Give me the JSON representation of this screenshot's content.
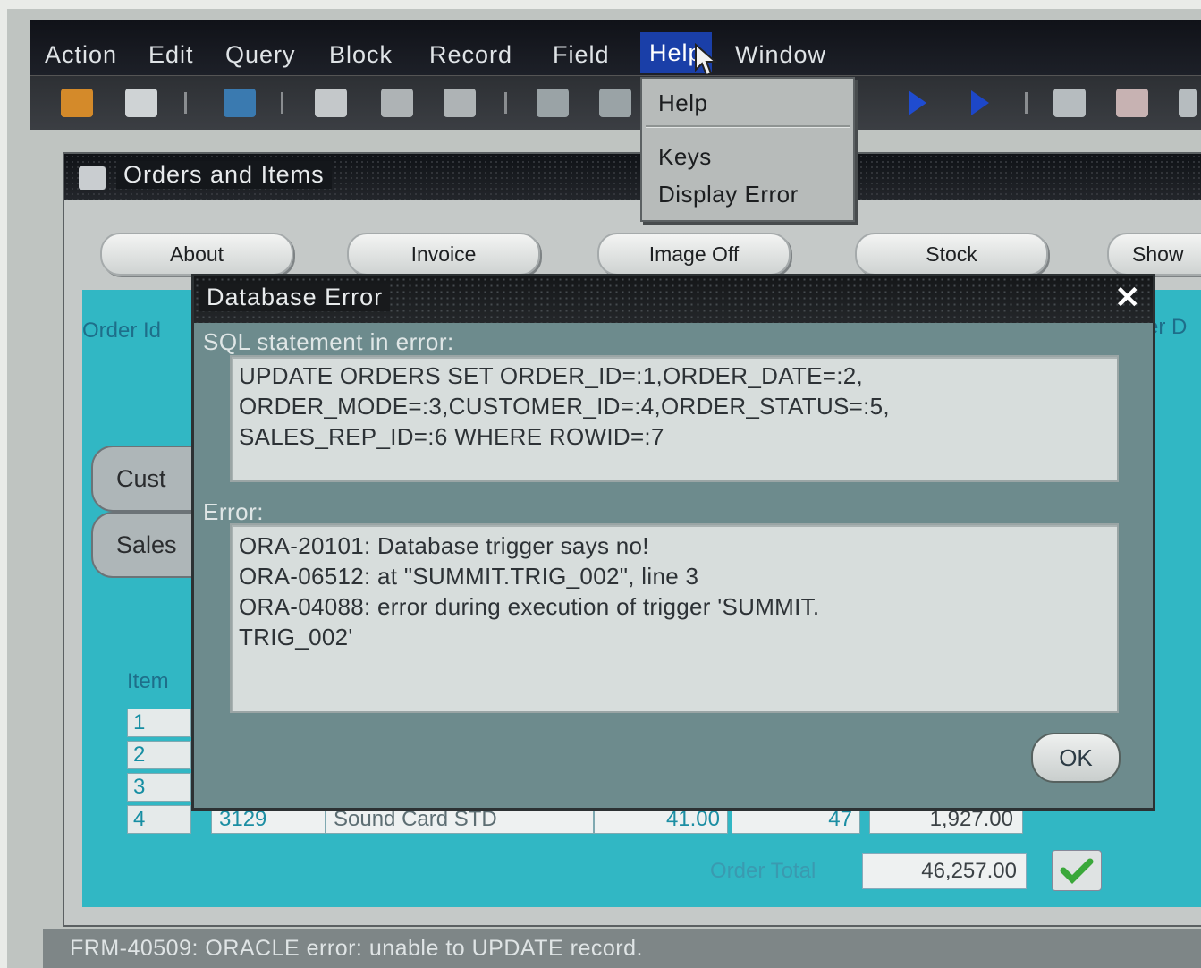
{
  "menubar": {
    "items": [
      "Action",
      "Edit",
      "Query",
      "Block",
      "Record",
      "Field",
      "Help",
      "Window"
    ]
  },
  "help_menu": {
    "items": [
      "Help",
      "Keys",
      "Display Error"
    ]
  },
  "window": {
    "title": "Orders and Items",
    "buttons": [
      "About",
      "Invoice",
      "Image Off",
      "Stock",
      "Show"
    ]
  },
  "form": {
    "order_id_label": "Order Id",
    "order_date_label_partial": "er D",
    "customer_tab": "Cust",
    "sales_tab": "Sales",
    "items_label": "Item",
    "row_numbers": [
      "1",
      "2",
      "3",
      "4"
    ],
    "visible_row": {
      "num": "4",
      "product_id": "3129",
      "description": "Sound Card STD",
      "price": "41.00",
      "quantity": "47",
      "item_total": "1,927.00"
    },
    "order_total_label": "Order Total",
    "order_total_value": "46,257.00"
  },
  "dialog": {
    "title": "Database Error",
    "close_glyph": "✕",
    "sql_label": "SQL statement in error:",
    "sql_lines": [
      "UPDATE ORDERS SET ORDER_ID=:1,ORDER_DATE=:2,",
      "ORDER_MODE=:3,CUSTOMER_ID=:4,ORDER_STATUS=:5,",
      "SALES_REP_ID=:6 WHERE ROWID=:7"
    ],
    "error_label": "Error:",
    "error_lines": [
      "ORA-20101: Database trigger says no!",
      "ORA-06512: at \"SUMMIT.TRIG_002\", line 3",
      "ORA-04088: error during execution of trigger 'SUMMIT.",
      "TRIG_002'"
    ],
    "ok_label": "OK"
  },
  "status": {
    "message": "FRM-40509: ORACLE error: unable to UPDATE record."
  },
  "colors": {
    "teal": "#31b7c4",
    "menu_highlight": "#1a3fa8",
    "dialog_bg": "#6d8b8d"
  }
}
